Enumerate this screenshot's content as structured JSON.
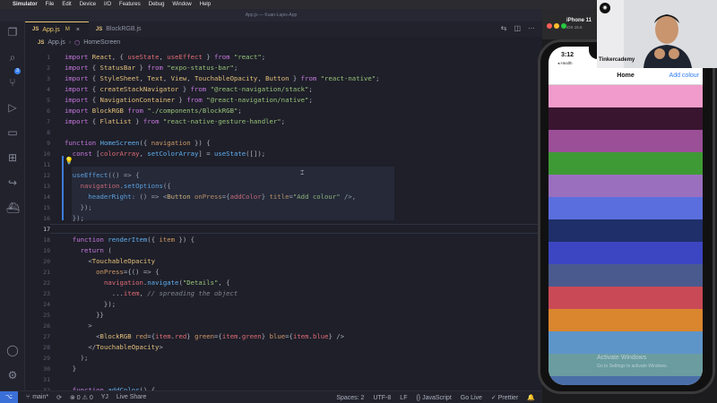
{
  "menubar": {
    "items": [
      "Simulator",
      "File",
      "Edit",
      "Device",
      "I/O",
      "Features",
      "Debug",
      "Window",
      "Help"
    ]
  },
  "window": {
    "title": "App.js — Kuan-Lapis-App"
  },
  "tabs": [
    {
      "label": "App.js",
      "modified": "M",
      "close": "×"
    },
    {
      "label": "BlockRGB.js",
      "close": ""
    }
  ],
  "breadcrumb": {
    "file": "App.js",
    "symbol": "HomeScreen"
  },
  "code_lines": [
    {
      "n": "1",
      "html": "<span class='k'>import</span> <span class='t'>React</span>, { <span class='v'>useState</span>, <span class='v'>useEffect</span> } <span class='k'>from</span> <span class='s'>\"react\"</span>;"
    },
    {
      "n": "2",
      "html": "<span class='k'>import</span> { <span class='t'>StatusBar</span> } <span class='k'>from</span> <span class='s'>\"expo-status-bar\"</span>;"
    },
    {
      "n": "3",
      "html": "<span class='k'>import</span> { <span class='t'>StyleSheet</span>, <span class='t'>Text</span>, <span class='t'>View</span>, <span class='t'>TouchableOpacity</span>, <span class='t'>Button</span> } <span class='k'>from</span> <span class='s'>\"react-native\"</span>;"
    },
    {
      "n": "4",
      "html": "<span class='k'>import</span> { <span class='t'>createStackNavigator</span> } <span class='k'>from</span> <span class='s'>\"@react-navigation/stack\"</span>;"
    },
    {
      "n": "5",
      "html": "<span class='k'>import</span> { <span class='t'>NavigationContainer</span> } <span class='k'>from</span> <span class='s'>\"@react-navigation/native\"</span>;"
    },
    {
      "n": "6",
      "html": "<span class='k'>import</span> <span class='t'>BlockRGB</span> <span class='k'>from</span> <span class='s'>\"./components/BlockRGB\"</span>;"
    },
    {
      "n": "7",
      "html": "<span class='k'>import</span> { <span class='t'>FlatList</span> } <span class='k'>from</span> <span class='s'>\"react-native-gesture-handler\"</span>;"
    },
    {
      "n": "8",
      "html": ""
    },
    {
      "n": "9",
      "html": "<span class='k'>function</span> <span class='f'>HomeScreen</span>({ <span class='a'>navigation</span> }) {"
    },
    {
      "n": "10",
      "html": "  <span class='k'>const</span> [<span class='v'>colorArray</span>, <span class='f'>setColorArray</span>] = <span class='f'>useState</span>([]);"
    },
    {
      "n": "11",
      "html": ""
    },
    {
      "n": "12",
      "html": "  <span class='f'>useEffect</span>(() =&gt; {"
    },
    {
      "n": "13",
      "html": "    <span class='v'>navigation</span>.<span class='f'>setOptions</span>({"
    },
    {
      "n": "14",
      "html": "      <span class='f'>headerRight</span>: () =&gt; &lt;<span class='t'>Button</span> <span class='a'>onPress</span>={<span class='v'>addColor</span>} <span class='a'>title</span>=<span class='s'>\"Add colour\"</span> /&gt;,"
    },
    {
      "n": "15",
      "html": "    });"
    },
    {
      "n": "16",
      "html": "  });"
    },
    {
      "n": "17",
      "html": ""
    },
    {
      "n": "18",
      "html": "  <span class='k'>function</span> <span class='f'>renderItem</span>({ <span class='a'>item</span> }) {"
    },
    {
      "n": "19",
      "html": "    <span class='k'>return</span> ("
    },
    {
      "n": "20",
      "html": "      &lt;<span class='t'>TouchableOpacity</span>"
    },
    {
      "n": "21",
      "html": "        <span class='a'>onPress</span>={() =&gt; {"
    },
    {
      "n": "22",
      "html": "          <span class='v'>navigation</span>.<span class='f'>navigate</span>(<span class='s'>\"Details\"</span>, {"
    },
    {
      "n": "23",
      "html": "            ...<span class='v'>item</span>, <span class='c'>// spreading the object</span>"
    },
    {
      "n": "24",
      "html": "          });"
    },
    {
      "n": "25",
      "html": "        }}"
    },
    {
      "n": "26",
      "html": "      &gt;"
    },
    {
      "n": "27",
      "html": "        &lt;<span class='t'>BlockRGB</span> <span class='a'>red</span>={<span class='v'>item</span>.<span class='v'>red</span>} <span class='a'>green</span>={<span class='v'>item</span>.<span class='v'>green</span>} <span class='a'>blue</span>={<span class='v'>item</span>.<span class='v'>blue</span>} /&gt;"
    },
    {
      "n": "28",
      "html": "      &lt;/<span class='t'>TouchableOpacity</span>&gt;"
    },
    {
      "n": "29",
      "html": "    );"
    },
    {
      "n": "30",
      "html": "  }"
    },
    {
      "n": "31",
      "html": ""
    },
    {
      "n": "32",
      "html": "  <span class='k'>function</span> <span class='f'>addColor</span>() {"
    }
  ],
  "current_line": "17",
  "statusbar": {
    "branch": "main*",
    "errors": "⊗ 0  ⚠ 0",
    "user": "YJ",
    "live_share": "Live Share",
    "spaces": "Spaces: 2",
    "encoding": "UTF-8",
    "eol": "LF",
    "language": "{} JavaScript",
    "go_live": "Go Live",
    "prettier": "✓ Prettier"
  },
  "simulator": {
    "device": "iPhone 11",
    "os": "iOS 15.5",
    "time": "3:12",
    "back": "◂ Health",
    "nav_title": "Home",
    "nav_button": "Add colour",
    "watermark_title": "Activate Windows",
    "watermark_sub": "Go to Settings to activate Windows.",
    "swatches": [
      "#f09bcb",
      "#3a1530",
      "#9a4f97",
      "#3e9a35",
      "#9a6fbe",
      "#5a6fdd",
      "#1f2f6a",
      "#3c46c2",
      "#4a5a8e",
      "#c94a56",
      "#d9862e",
      "#5e95c9",
      "#6a9ca0",
      "#4a6fa8"
    ]
  },
  "webcam": {
    "label": "Tinkercademy"
  }
}
